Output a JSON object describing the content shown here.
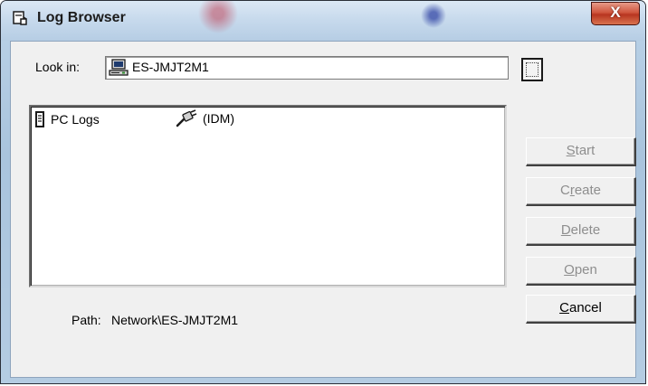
{
  "window": {
    "title": "Log Browser",
    "close_label": "X"
  },
  "look_in": {
    "label": "Look in:",
    "value": "ES-JMJT2M1",
    "icon": "computer-icon"
  },
  "list": {
    "items": [
      {
        "label": "PC Logs",
        "icon": "log-book-icon"
      },
      {
        "label": "(IDM)",
        "icon": "network-plug-icon"
      }
    ]
  },
  "path": {
    "label": "Path:",
    "value": "Network\\ES-JMJT2M1"
  },
  "buttons": {
    "start": {
      "accel": "S",
      "rest": "tart",
      "enabled": false
    },
    "create": {
      "pre": "C",
      "accel": "r",
      "rest": "eate",
      "enabled": false
    },
    "delete": {
      "accel": "D",
      "rest": "elete",
      "enabled": false
    },
    "open": {
      "accel": "O",
      "rest": "pen",
      "enabled": false
    },
    "cancel": {
      "accel": "C",
      "rest": "ancel",
      "enabled": true
    }
  }
}
